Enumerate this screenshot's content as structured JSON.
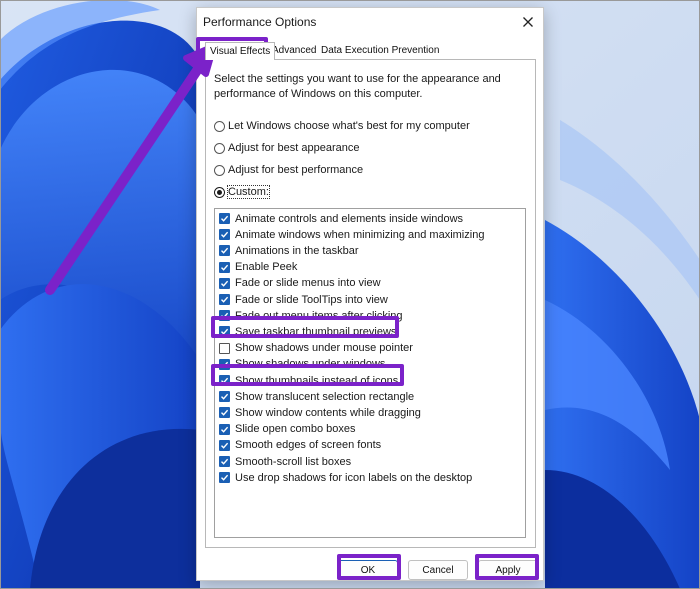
{
  "dialog": {
    "title": "Performance Options",
    "tabs": [
      {
        "label": "Visual Effects",
        "active": true
      },
      {
        "label": "Advanced",
        "active": false
      },
      {
        "label": "Data Execution Prevention",
        "active": false
      }
    ],
    "intro": "Select the settings you want to use for the appearance and performance of Windows on this computer.",
    "radios": [
      {
        "label": "Let Windows choose what's best for my computer",
        "checked": false
      },
      {
        "label": "Adjust for best appearance",
        "checked": false
      },
      {
        "label": "Adjust for best performance",
        "checked": false
      },
      {
        "label": "Custom:",
        "checked": true
      }
    ],
    "effects": [
      {
        "label": "Animate controls and elements inside windows",
        "checked": true
      },
      {
        "label": "Animate windows when minimizing and maximizing",
        "checked": true
      },
      {
        "label": "Animations in the taskbar",
        "checked": true
      },
      {
        "label": "Enable Peek",
        "checked": true
      },
      {
        "label": "Fade or slide menus into view",
        "checked": true
      },
      {
        "label": "Fade or slide ToolTips into view",
        "checked": true
      },
      {
        "label": "Fade out menu items after clicking",
        "checked": true
      },
      {
        "label": "Save taskbar thumbnail previews",
        "checked": true
      },
      {
        "label": "Show shadows under mouse pointer",
        "checked": false
      },
      {
        "label": "Show shadows under windows",
        "checked": true
      },
      {
        "label": "Show thumbnails instead of icons",
        "checked": true
      },
      {
        "label": "Show translucent selection rectangle",
        "checked": true
      },
      {
        "label": "Show window contents while dragging",
        "checked": true
      },
      {
        "label": "Slide open combo boxes",
        "checked": true
      },
      {
        "label": "Smooth edges of screen fonts",
        "checked": true
      },
      {
        "label": "Smooth-scroll list boxes",
        "checked": true
      },
      {
        "label": "Use drop shadows for icon labels on the desktop",
        "checked": true
      }
    ],
    "buttons": {
      "ok": "OK",
      "cancel": "Cancel",
      "apply": "Apply"
    }
  },
  "colors": {
    "annotation": "#7b22c9",
    "checkbox_accent": "#1a5fb4"
  },
  "icons": {
    "close": "close-icon",
    "check": "checkmark-icon",
    "arrow": "annotation-arrow-icon"
  }
}
